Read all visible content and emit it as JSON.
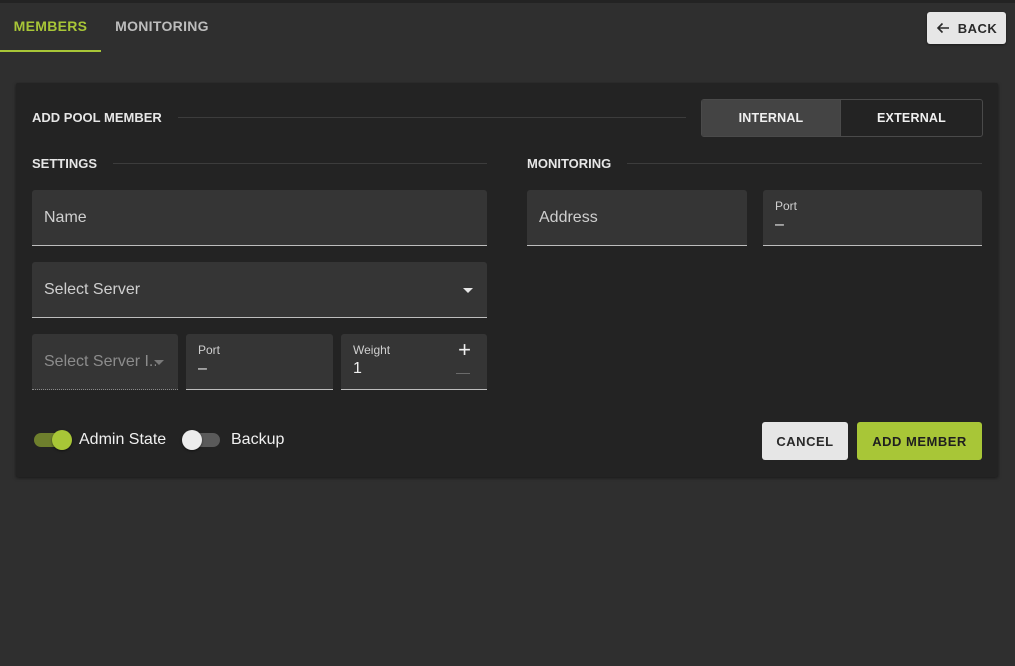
{
  "tabs": [
    {
      "label": "MEMBERS",
      "active": true
    },
    {
      "label": "MONITORING",
      "active": false
    }
  ],
  "back_button": {
    "label": "BACK",
    "icon": "arrow-left-icon"
  },
  "card": {
    "title": "ADD POOL MEMBER",
    "member_type": {
      "options": [
        "INTERNAL MEMBER",
        "EXTERNAL MEMBER"
      ],
      "selected": "INTERNAL MEMBER"
    },
    "settings": {
      "heading": "SETTINGS",
      "name_placeholder": "Name",
      "server_placeholder": "Select Server",
      "server_interface_placeholder": "Select Server I...",
      "port_label": "Port",
      "port_value": "–",
      "weight_label": "Weight",
      "weight_value": "1"
    },
    "monitoring": {
      "heading": "MONITORING",
      "address_placeholder": "Address",
      "port_label": "Port",
      "port_value": "–"
    },
    "switches": {
      "admin_state": {
        "label": "Admin State",
        "on": true
      },
      "backup": {
        "label": "Backup",
        "on": false
      }
    },
    "actions": {
      "cancel": "CANCEL",
      "add": "ADD MEMBER"
    }
  },
  "colors": {
    "accent": "#a8c637",
    "background": "#2f2f2f",
    "card": "#232323"
  }
}
